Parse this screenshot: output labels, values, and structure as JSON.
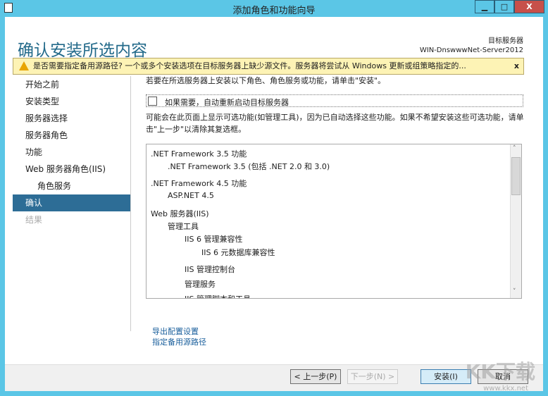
{
  "window": {
    "title": "添加角色和功能向导",
    "minimize": "▁",
    "maximize": "□",
    "close": "X"
  },
  "header": {
    "page_title": "确认安装所选内容",
    "target_label": "目标服务器",
    "target_server": "WIN-DnswwwNet-Server2012"
  },
  "warning": {
    "text": "是否需要指定备用源路径? 一个或多个安装选项在目标服务器上缺少源文件。服务器将尝试从 Windows 更新或组策略指定的...",
    "close": "x"
  },
  "sidebar": {
    "items": [
      {
        "label": "开始之前"
      },
      {
        "label": "安装类型"
      },
      {
        "label": "服务器选择"
      },
      {
        "label": "服务器角色"
      },
      {
        "label": "功能"
      },
      {
        "label": "Web 服务器角色(IIS)"
      },
      {
        "label": "角色服务"
      },
      {
        "label": "确认"
      },
      {
        "label": "结果"
      }
    ]
  },
  "main": {
    "intro": "若要在所选服务器上安装以下角色、角色服务或功能，请单击\"安装\"。",
    "restart_label": "如果需要，自动重新启动目标服务器",
    "restart_checked": false,
    "note": "可能会在此页面上显示可选功能(如管理工具)，因为已自动选择这些功能。如果不希望安装这些可选功能，请单击\"上一步\"以清除其复选框。",
    "items": [
      {
        "label": ".NET Framework 3.5 功能"
      },
      {
        "label": ".NET Framework 3.5 (包括 .NET 2.0 和 3.0)"
      },
      {
        "label": ".NET Framework 4.5 功能"
      },
      {
        "label": "ASP.NET 4.5"
      },
      {
        "label": "Web 服务器(IIS)"
      },
      {
        "label": "管理工具"
      },
      {
        "label": "IIS 6 管理兼容性"
      },
      {
        "label": "IIS 6 元数据库兼容性"
      },
      {
        "label": "IIS 管理控制台"
      },
      {
        "label": "管理服务"
      },
      {
        "label": "IIS 管理脚本和工具"
      }
    ]
  },
  "links": {
    "export": "导出配置设置",
    "alt_source": "指定备用源路径"
  },
  "buttons": {
    "previous": "< 上一步(P)",
    "next": "下一步(N) >",
    "install": "安装(I)",
    "cancel": "取消"
  },
  "watermark": {
    "logo": "KK下载",
    "url": "www.kkx.net"
  }
}
